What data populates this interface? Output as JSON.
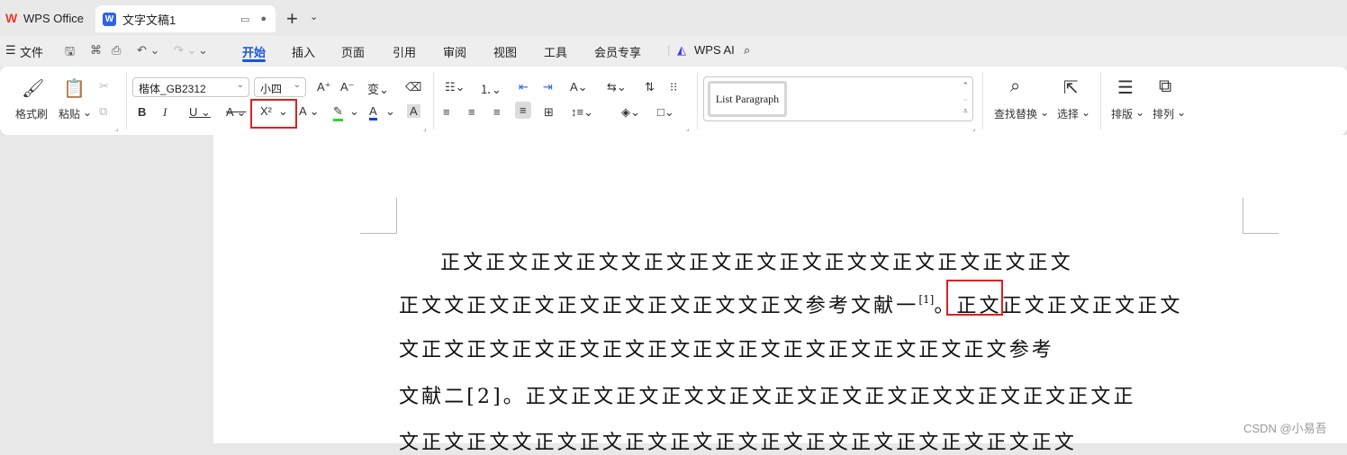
{
  "tabs": {
    "wps_office": "WPS Office",
    "document": "文字文稿1",
    "add": "+"
  },
  "menu": {
    "file": "文件",
    "items": [
      "开始",
      "插入",
      "页面",
      "引用",
      "审阅",
      "视图",
      "工具",
      "会员专享"
    ],
    "wps_ai": "WPS AI"
  },
  "ribbon": {
    "format_painter": "格式刷",
    "paste": "粘贴",
    "font_name": "楷体_GB2312",
    "font_size": "小四",
    "style_name": "List Paragraph",
    "find_replace": "查找替换",
    "select": "选择",
    "typeset": "排版",
    "arrange": "排列",
    "superscript": "X²"
  },
  "document": {
    "line1": "正文正文正文正文文正文正文正文正文正文文正文正文正文正文",
    "line2_a": "正文文正文正文正文正文正文正文文正文参考文献一",
    "line2_sup": "[1]",
    "line2_b": "。正文正文正文正文正文",
    "line3": "文正文正文正文正文正文正文正文正文正文正文正文正文正文参考",
    "line4": "文献二[2]。正文正文正文正文文正文正文正文正文正文文正文正文正文正",
    "line5": "文正文正文文正文正文正文正文正文正文正文正文正文正文正文正文"
  },
  "watermark": "CSDN @小易吾",
  "colors": {
    "accent": "#1a56db",
    "highlight_box": "#e02020",
    "font_color": "#1a3fd6",
    "highlight_color": "#2bd62b"
  }
}
